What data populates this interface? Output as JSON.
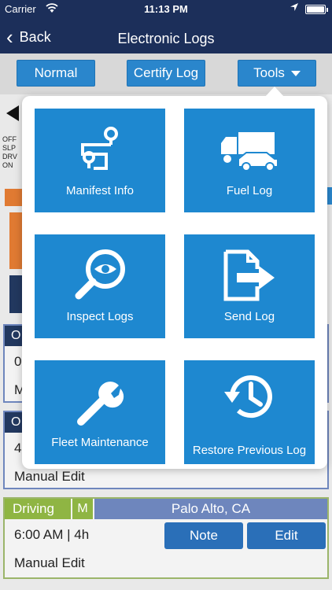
{
  "status_bar": {
    "carrier": "Carrier",
    "time": "11:13 PM",
    "battery_level": 0.92
  },
  "nav": {
    "back_label": "Back",
    "title": "Electronic Logs"
  },
  "toolbar": {
    "normal_label": "Normal",
    "certify_label": "Certify Log",
    "tools_label": "Tools"
  },
  "background": {
    "graph_labels": [
      "OFF",
      "SLP",
      "DRV",
      "ON"
    ],
    "card1": {
      "status": "O",
      "time": "0",
      "foot": "M"
    },
    "card2": {
      "status": "O",
      "time": "4",
      "foot": "Manual Edit"
    },
    "card3": {
      "status": "Driving",
      "m": "M",
      "location": "Palo Alto,  CA",
      "time": "6:00 AM | 4h",
      "note_label": "Note",
      "edit_label": "Edit",
      "foot": "Manual Edit"
    }
  },
  "tools_menu": {
    "items": [
      {
        "label": "Manifest Info",
        "icon": "route-pin-icon"
      },
      {
        "label": "Fuel Log",
        "icon": "truck-car-icon"
      },
      {
        "label": "Inspect Logs",
        "icon": "magnifier-eye-icon"
      },
      {
        "label": "Send Log",
        "icon": "document-arrow-icon"
      },
      {
        "label": "Fleet Maintenance",
        "icon": "wrench-icon"
      },
      {
        "label": "Restore Previous Log",
        "icon": "history-clock-icon"
      }
    ]
  },
  "colors": {
    "nav_bg": "#1c2f5a",
    "button_blue": "#2a86cc",
    "tile_blue": "#1e88d0",
    "driving_green": "#8fb543",
    "location_blue": "#6e86bd"
  }
}
